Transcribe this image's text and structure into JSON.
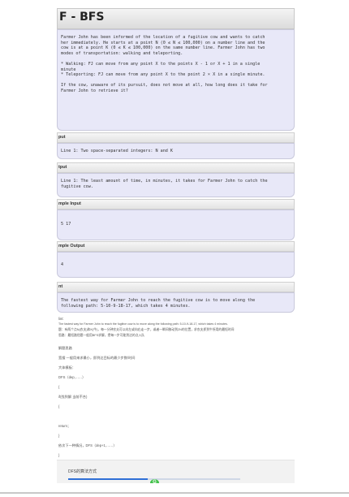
{
  "title": "F - BFS",
  "description": "Farmer John has been informed of the location of a fugitive cow and wants to catch\nher immediately. He starts at a point N (0 ≤ N ≤ 100,000) on a number line and the\ncow is at a point K (0 ≤ K ≤ 100,000) on the same number line. Farmer John has two\nmodes of transportation: walking and teleporting.\n\n* Walking: FJ can move from any point X to the points X - 1 or X + 1 in a single\nminute\n* Teleporting: FJ can move from any point X to the point 2 × X in a single minute.\n\nIf the cow, unaware of its pursuit, does not move at all, how long does it take for\nFarmer John to retrieve it?",
  "sections": {
    "input_head": "put",
    "input_body": "Line 1: Two space-separated integers: N and K",
    "output_head": "tput",
    "output_body": "Line 1: The least amount of time, in minutes, it takes for Farmer John to catch the\nfugitive cow.",
    "sample_input_head": "mple Input",
    "sample_input_body": "5 17",
    "sample_output_head": "mple Output",
    "sample_output_body": "4",
    "hint_head": "nt",
    "hint_body": "The fastest way for Farmer John to reach the fugitive cow is to move along the\nfollowing path: 5-10-9-18-17, which takes 4 minutes."
  },
  "notes": [
    "lint:",
    "The fastest way for Farmer John to reach the fugitive cow is to move along the following path: 5-10-9-18-17, which takes 4 minutes.",
    "题：有两个点N(农夫)和K(牛)，每一分钟农夫可以向左或向右走一步，或者一瞬间移动到2N的位置，求农夫抓到牛所用的最短时间",
    "思路：最短路径题一般用BFS求解，把每一步可能到达的点入队",
    "解题思路",
    "宽搜  一般用来求最小，即到达目标的最少步数/时间",
    "大体模板：",
    "DFS（dep,……）",
    "{",
    "    if(找到解    当前不合)",
    "    {",
    "",
    "        return；",
    "    }",
    "    依次下一种情况，DFS（dep+1,……）",
    "}"
  ],
  "footer": {
    "label": "DFS的算法方式",
    "progress": 0.46,
    "bubble": "G"
  }
}
